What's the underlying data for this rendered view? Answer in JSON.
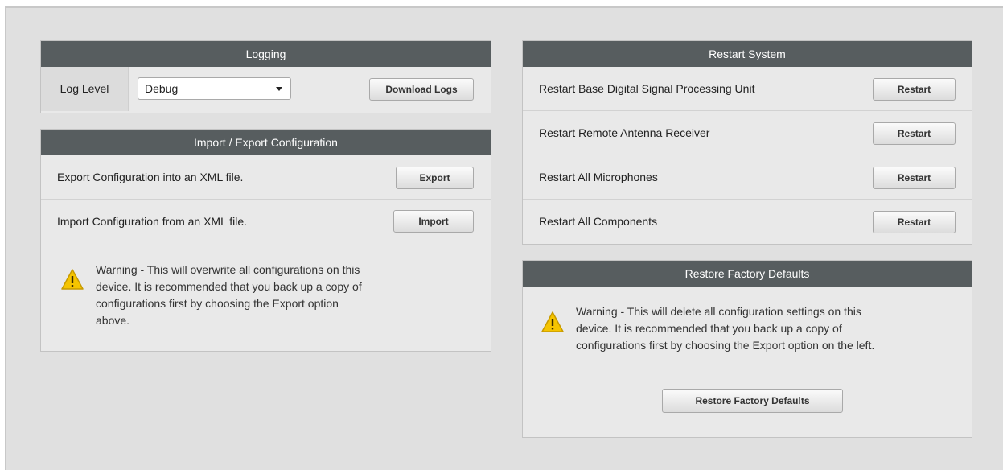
{
  "logging": {
    "title": "Logging",
    "log_level_label": "Log Level",
    "log_level_value": "Debug",
    "download_button": "Download Logs"
  },
  "import_export": {
    "title": "Import / Export Configuration",
    "export_label": "Export Configuration into an XML file.",
    "export_button": "Export",
    "import_label": "Import Configuration from an XML file.",
    "import_button": "Import",
    "warning_lines": [
      "Warning - This will overwrite all configurations on this",
      "device. It is recommended that you back up a copy of",
      "configurations first by choosing the Export option",
      "above."
    ]
  },
  "restart": {
    "title": "Restart System",
    "items": [
      {
        "label": "Restart Base Digital Signal Processing Unit",
        "button": "Restart"
      },
      {
        "label": "Restart Remote Antenna Receiver",
        "button": "Restart"
      },
      {
        "label": "Restart All Microphones",
        "button": "Restart"
      },
      {
        "label": "Restart All Components",
        "button": "Restart"
      }
    ]
  },
  "factory": {
    "title": "Restore Factory Defaults",
    "warning_lines": [
      "Warning - This will delete all configuration settings on this",
      "device. It is recommended that you back up a copy of",
      "configurations first by choosing the Export option on the left."
    ],
    "button": "Restore Factory Defaults"
  },
  "icons": {
    "warning": "warning-triangle-icon",
    "dropdown": "chevron-down-icon"
  },
  "colors": {
    "header_bg": "#575d5f",
    "panel_bg": "#e9e9e9",
    "page_bg": "#e0e0e0",
    "warning_yellow": "#f5c400"
  }
}
